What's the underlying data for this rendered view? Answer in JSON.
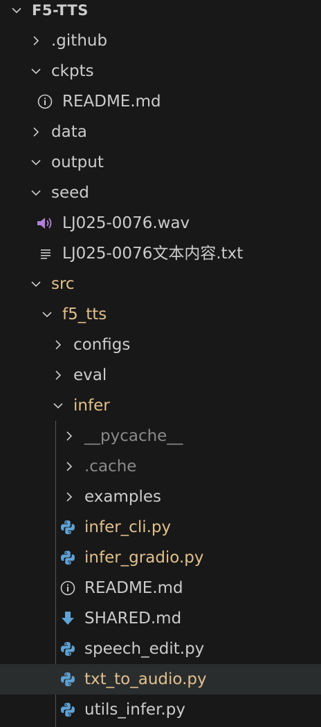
{
  "explorer": {
    "root": {
      "label": "F5-TTS"
    },
    "items": [
      {
        "label": ".github"
      },
      {
        "label": "ckpts"
      },
      {
        "label": "README.md",
        "icon": "info-icon"
      },
      {
        "label": "data"
      },
      {
        "label": "output"
      },
      {
        "label": "seed"
      },
      {
        "label": "LJ025-0076.wav",
        "icon": "audio-icon"
      },
      {
        "label": "LJ025-0076文本内容.txt",
        "icon": "text-file-icon"
      },
      {
        "label": "src"
      },
      {
        "label": "f5_tts"
      },
      {
        "label": "configs"
      },
      {
        "label": "eval"
      },
      {
        "label": "infer"
      },
      {
        "label": "__pycache__"
      },
      {
        "label": ".cache"
      },
      {
        "label": "examples"
      },
      {
        "label": "infer_cli.py",
        "icon": "python-icon"
      },
      {
        "label": "infer_gradio.py",
        "icon": "python-icon"
      },
      {
        "label": "README.md",
        "icon": "info-icon"
      },
      {
        "label": "SHARED.md",
        "icon": "download-arrow-icon"
      },
      {
        "label": "speech_edit.py",
        "icon": "python-icon"
      },
      {
        "label": "txt_to_audio.py",
        "icon": "python-icon"
      },
      {
        "label": "utils_infer.py",
        "icon": "python-icon"
      }
    ]
  },
  "colors": {
    "background": "#181818",
    "text": "#cccccc",
    "modified_folder": "#e2c08d",
    "ignored": "#8a8a8a",
    "python_icon": "#5fa3d6",
    "audio_icon": "#b180d7",
    "selection": "#2a2d2e"
  }
}
